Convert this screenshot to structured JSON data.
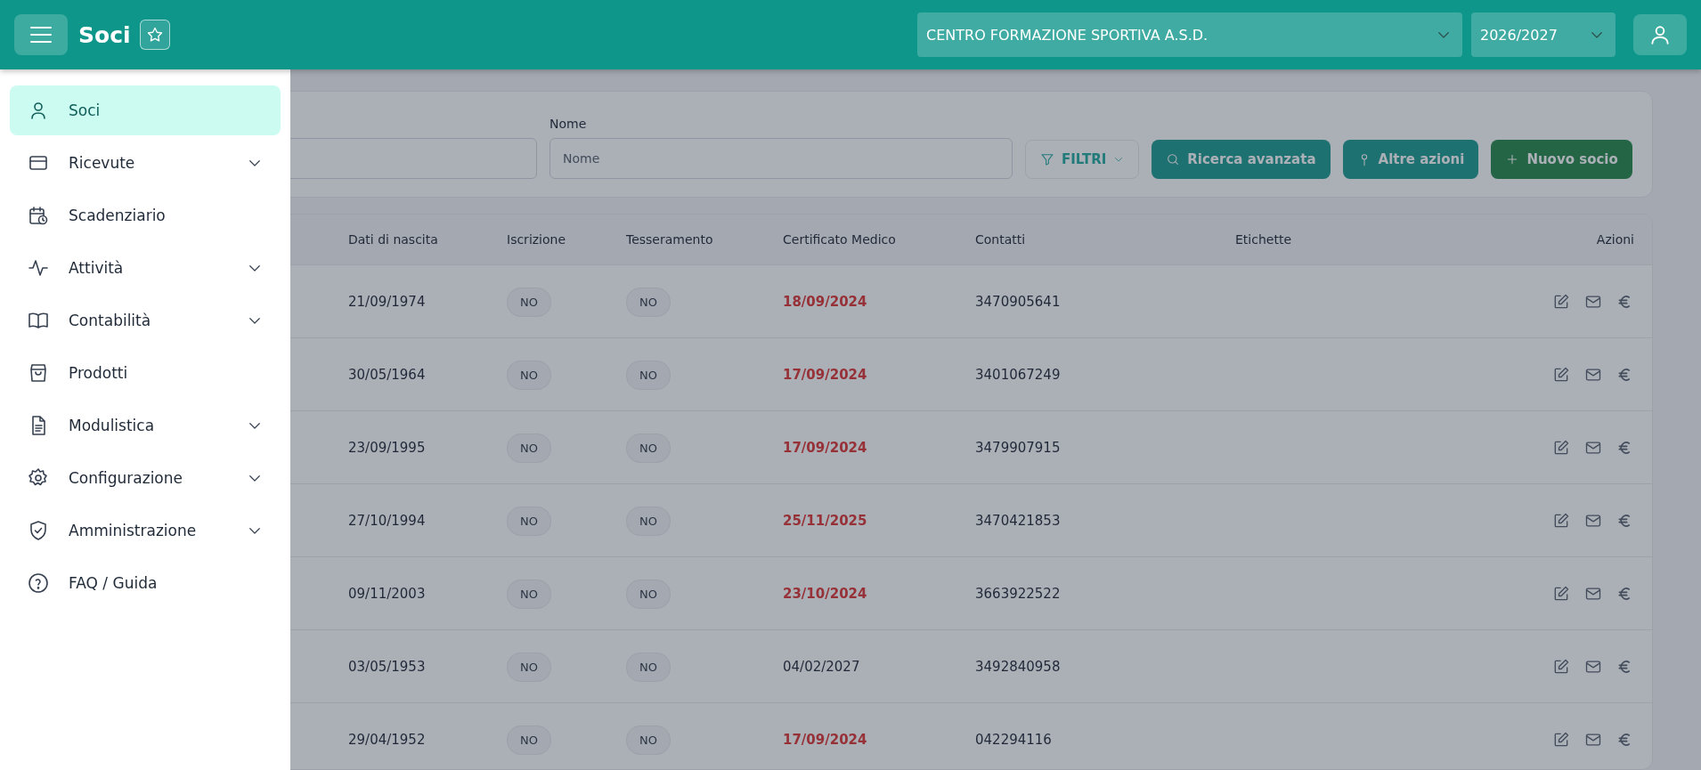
{
  "header": {
    "title": "Soci",
    "organization": "CENTRO FORMAZIONE SPORTIVA A.S.D.",
    "season": "2026/2027"
  },
  "sidebar": {
    "items": [
      {
        "label": "Soci",
        "kind": "user",
        "selected": true,
        "expandable": false
      },
      {
        "label": "Ricevute",
        "kind": "card",
        "selected": false,
        "expandable": true
      },
      {
        "label": "Scadenziario",
        "kind": "calendar",
        "selected": false,
        "expandable": false
      },
      {
        "label": "Attività",
        "kind": "pulse",
        "selected": false,
        "expandable": true
      },
      {
        "label": "Contabilità",
        "kind": "book",
        "selected": false,
        "expandable": true
      },
      {
        "label": "Prodotti",
        "kind": "bag",
        "selected": false,
        "expandable": false
      },
      {
        "label": "Modulistica",
        "kind": "file",
        "selected": false,
        "expandable": true
      },
      {
        "label": "Configurazione",
        "kind": "gear",
        "selected": false,
        "expandable": true
      },
      {
        "label": "Amministrazione",
        "kind": "shield",
        "selected": false,
        "expandable": true
      },
      {
        "label": "FAQ / Guida",
        "kind": "help",
        "selected": false,
        "expandable": false
      }
    ]
  },
  "filters": {
    "name_label": "Nome",
    "name_placeholder": "Nome",
    "buttons": [
      {
        "label": "FILTRI",
        "kind": "filter"
      },
      {
        "label": "Ricerca avanzata",
        "kind": "search"
      },
      {
        "label": "Altre azioni",
        "kind": "actions"
      },
      {
        "label": "Nuovo socio",
        "kind": "new"
      }
    ]
  },
  "table": {
    "columns": [
      "Dati di nascita",
      "Iscrizione",
      "Tesseramento",
      "Certificato Medico",
      "Contatti",
      "Etichette",
      "Azioni"
    ],
    "rows": [
      {
        "birth": "21/09/1974",
        "enrolment": "NO",
        "membership": "NO",
        "certificate": "18/09/2024",
        "expired": true,
        "contact": "3470905641"
      },
      {
        "birth": "30/05/1964",
        "enrolment": "NO",
        "membership": "NO",
        "certificate": "17/09/2024",
        "expired": true,
        "contact": "3401067249"
      },
      {
        "birth": "23/09/1995",
        "enrolment": "NO",
        "membership": "NO",
        "certificate": "17/09/2024",
        "expired": true,
        "contact": "3479907915"
      },
      {
        "birth": "27/10/1994",
        "enrolment": "NO",
        "membership": "NO",
        "certificate": "25/11/2025",
        "expired": true,
        "contact": "3470421853"
      },
      {
        "birth": "09/11/2003",
        "enrolment": "NO",
        "membership": "NO",
        "certificate": "23/10/2024",
        "expired": true,
        "contact": "3663922522"
      },
      {
        "birth": "03/05/1953",
        "enrolment": "NO",
        "membership": "NO",
        "certificate": "04/02/2027",
        "expired": false,
        "contact": "3492840958"
      },
      {
        "birth": "29/04/1952",
        "enrolment": "NO",
        "membership": "NO",
        "certificate": "17/09/2024",
        "expired": true,
        "contact": "042294116"
      }
    ]
  }
}
